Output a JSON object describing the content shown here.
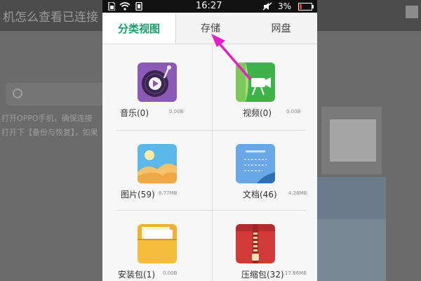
{
  "status_bar": {
    "time": "16:27",
    "battery_percent": "3%",
    "icons": [
      "sim-icon",
      "wifi-icon",
      "vibrate-icon",
      "mute-icon",
      "battery-icon"
    ]
  },
  "tabs": [
    {
      "label": "分类视图",
      "active": true
    },
    {
      "label": "存储",
      "active": false
    },
    {
      "label": "网盘",
      "active": false
    }
  ],
  "categories": [
    {
      "label": "音乐(0)",
      "size": "0.00B",
      "icon": "music-icon",
      "color": "#8b5ab7"
    },
    {
      "label": "视频(0)",
      "size": "0.00B",
      "icon": "video-icon",
      "color": "#3fb24a"
    },
    {
      "label": "图片(59)",
      "size": "6.77MB",
      "icon": "picture-icon",
      "color": "#5cb8ea"
    },
    {
      "label": "文档(46)",
      "size": "4.26MB",
      "icon": "document-icon",
      "color": "#4a90d9"
    },
    {
      "label": "安装包(1)",
      "size": "0.00B",
      "icon": "package-icon",
      "color": "#f2b12c"
    },
    {
      "label": "压缩包(32)",
      "size": "17.86MB",
      "icon": "zip-icon",
      "color": "#d23a3a"
    }
  ],
  "background_page": {
    "title": "机怎么查看已连接",
    "lines": [
      "打开OPPO手机，确保连接",
      "打开下【备份与恢复】，如果"
    ]
  },
  "colors": {
    "accent": "#1a9e6b",
    "pointer_arrow": "#e81cc8"
  }
}
